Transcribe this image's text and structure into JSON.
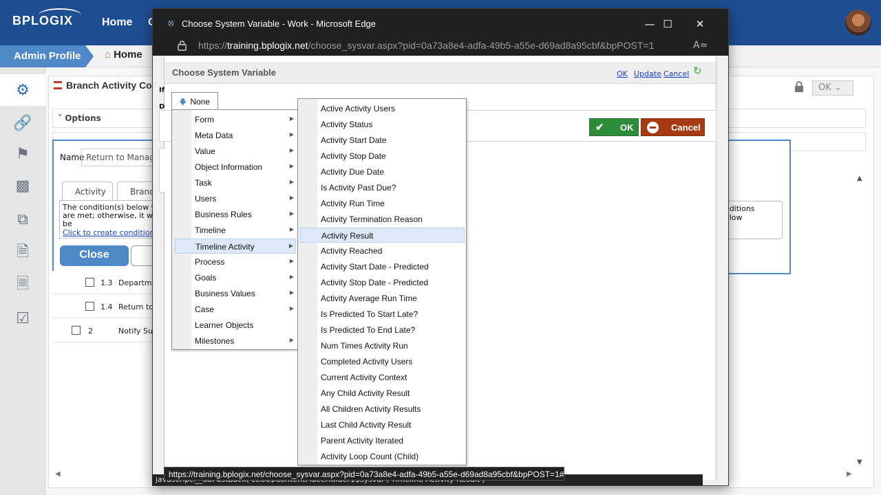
{
  "app": {
    "logo": "BPLOGIX",
    "nav": [
      "Home",
      "C"
    ],
    "breadcrumb": {
      "admin": "Admin Profile",
      "home": "Home"
    },
    "panel_title": "Branch Activity Con",
    "ok_dropdown": "OK",
    "options_label": "Options",
    "name_label": "Name",
    "name_value": "Return to Manage",
    "tabs": [
      "Activity",
      "Branch"
    ],
    "condition_text": "The condition(s) below will are met; otherwise, it will be",
    "condition_link": "Click to create condition ...",
    "condition_text_right": "onditions below",
    "close_button": "Close",
    "rows": [
      {
        "num": "1.3",
        "label": "Departm"
      },
      {
        "num": "1.4",
        "label": "Return to"
      },
      {
        "num": "2",
        "label": "Notify Sub"
      }
    ],
    "bg_labels": {
      "if": "If",
      "d": "D"
    }
  },
  "popup": {
    "window_title": "Choose System Variable - Work - Microsoft Edge",
    "url_prefix": "https://",
    "url_host": "training.bplogix.net",
    "url_path": "/choose_sysvar.aspx?pid=0a73a8e4-adfa-49b5-a55e-d69ad8a95cbf&bpPOST=1",
    "header_title": "Choose System Variable",
    "header_links": {
      "ok": "OK",
      "update": "Update",
      "cancel": "Cancel"
    },
    "ok_button": "OK",
    "cancel_button": "Cancel",
    "dropdown_value": "None",
    "status_url": "https://training.bplogix.net/choose_sysvar.aspx?pid=0a73a8e4-adfa-49b5-a55e-d69ad8a95cbf&bpPOST=1#",
    "js_strip": "javascript:__doPostBack('ctl00$ContentPlaceHolder1$sysvar','Timeline Activity Result')"
  },
  "menu1": {
    "items": [
      {
        "label": "Form",
        "has_sub": true
      },
      {
        "label": "Meta Data",
        "has_sub": true
      },
      {
        "label": "Value",
        "has_sub": true
      },
      {
        "label": "Object Information",
        "has_sub": true
      },
      {
        "label": "Task",
        "has_sub": true
      },
      {
        "label": "Users",
        "has_sub": true
      },
      {
        "label": "Business Rules",
        "has_sub": true
      },
      {
        "label": "Timeline",
        "has_sub": true
      },
      {
        "label": "Timeline Activity",
        "has_sub": true
      },
      {
        "label": "Process",
        "has_sub": true
      },
      {
        "label": "Goals",
        "has_sub": true
      },
      {
        "label": "Business Values",
        "has_sub": true
      },
      {
        "label": "Case",
        "has_sub": true
      },
      {
        "label": "Learner Objects",
        "has_sub": false
      },
      {
        "label": "Milestones",
        "has_sub": true
      }
    ],
    "highlighted": "Timeline Activity"
  },
  "menu2": {
    "items": [
      "Active Activity Users",
      "Activity Status",
      "Activity Start Date",
      "Activity Stop Date",
      "Activity Due Date",
      "Is Activity Past Due?",
      "Activity Run Time",
      "Activity Termination Reason",
      "Activity Result",
      "Activity Reached",
      "Activity Start Date - Predicted",
      "Activity Stop Date - Predicted",
      "Activity Average Run Time",
      "Is Predicted To Start Late?",
      "Is Predicted To End Late?",
      "Num Times Activity Run",
      "Completed Activity Users",
      "Current Activity Context",
      "Any Child Activity Result",
      "All Children Activity Results",
      "Last Child Activity Result",
      "Parent Activity Iterated",
      "Activity Loop Count (Child)"
    ],
    "highlighted": "Activity Result"
  },
  "colors": {
    "brand": "#1e4e92",
    "accent": "#4f88c6",
    "ok_green": "#2e8b3a",
    "cancel_red": "#a63a12",
    "menu_highlight": "#dde9f8"
  }
}
